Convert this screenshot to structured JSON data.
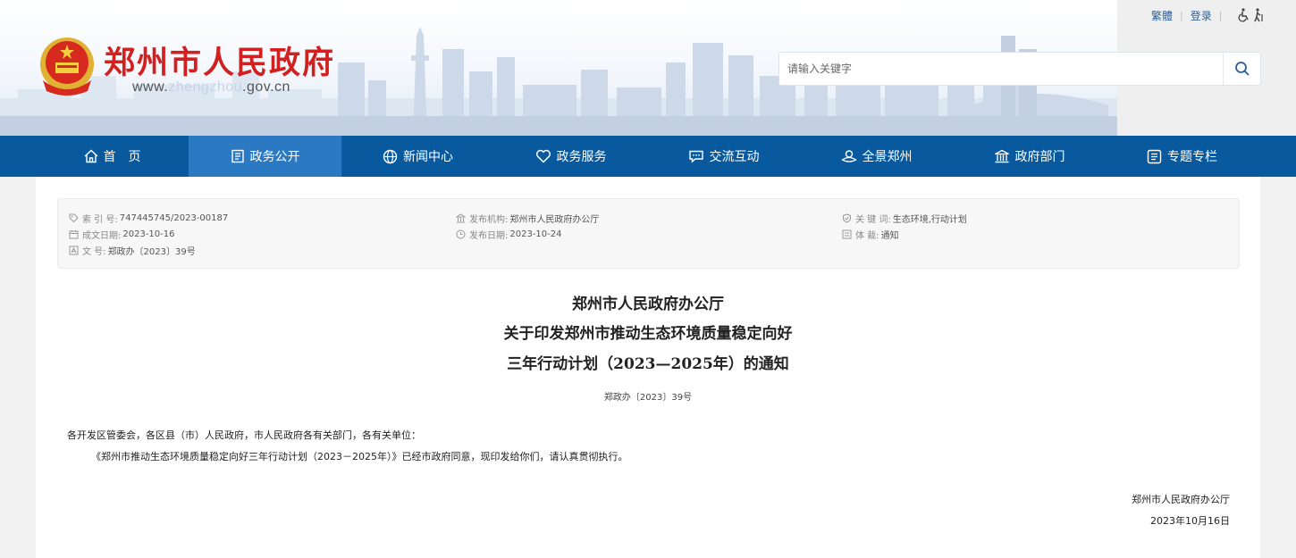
{
  "header": {
    "site_title": "郑州市人民政府",
    "url_prefix": "www.",
    "url_highlight": "zhengzhou",
    "url_suffix": ".gov.cn",
    "top_links": {
      "traditional": "繁體",
      "login": "登录"
    },
    "search": {
      "placeholder": "请输入关键字"
    }
  },
  "nav": {
    "items": [
      {
        "label": "首　页",
        "icon": "home-icon"
      },
      {
        "label": "政务公开",
        "icon": "document-icon",
        "active": true
      },
      {
        "label": "新闻中心",
        "icon": "globe-icon"
      },
      {
        "label": "政务服务",
        "icon": "heart-icon"
      },
      {
        "label": "交流互动",
        "icon": "chat-icon"
      },
      {
        "label": "全景郑州",
        "icon": "panorama-icon"
      },
      {
        "label": "政府部门",
        "icon": "building-icon"
      },
      {
        "label": "专题专栏",
        "icon": "topic-icon"
      }
    ]
  },
  "meta": {
    "index_key": "索  引  号:",
    "index_val": "747445745/2023-00187",
    "publisher_key": "发布机构:",
    "publisher_val": "郑州市人民政府办公厅",
    "keywords_key": "关  键  词:",
    "keywords_val": "生态环境,行动计划",
    "created_key": "成文日期:",
    "created_val": "2023-10-16",
    "published_key": "发布日期:",
    "published_val": "2023-10-24",
    "genre_key": "体        裁:",
    "genre_val": "通知",
    "docno_key": "文        号:",
    "docno_val": "郑政办〔2023〕39号"
  },
  "document": {
    "title_line1": "郑州市人民政府办公厅",
    "title_line2": "关于印发郑州市推动生态环境质量稳定向好",
    "title_line3": "三年行动计划（2023—2025年）的通知",
    "doc_number": "郑政办〔2023〕39号",
    "salutation": "各开发区管委会，各区县（市）人民政府，市人民政府各有关部门，各有关单位：",
    "body": "《郑州市推动生态环境质量稳定向好三年行动计划（2023－2025年）》已经市政府同意，现印发给你们，请认真贯彻执行。",
    "sign_org": "郑州市人民政府办公厅",
    "sign_date": "2023年10月16日"
  },
  "colors": {
    "brand_red": "#d1201f",
    "nav_blue": "#09599e",
    "nav_active": "#2a79c2",
    "link_blue": "#2b5d98"
  }
}
